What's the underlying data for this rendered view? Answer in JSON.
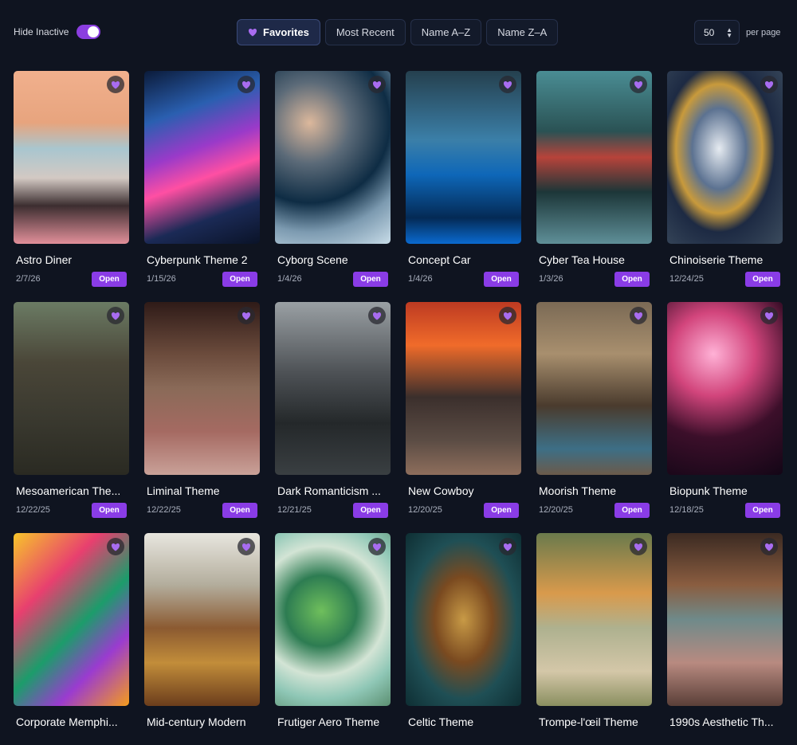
{
  "filters": {
    "hide_inactive_label": "Hide Inactive",
    "hide_inactive_on": true
  },
  "sort": {
    "options": [
      {
        "label": "Favorites",
        "active": true,
        "icon": "heart-icon"
      },
      {
        "label": "Most Recent",
        "active": false
      },
      {
        "label": "Name A–Z",
        "active": false
      },
      {
        "label": "Name Z–A",
        "active": false
      }
    ]
  },
  "pagination": {
    "per_page_value": "50",
    "per_page_label": "per page"
  },
  "colors": {
    "accent": "#8a3ce6",
    "background": "#0f1420"
  },
  "cards": [
    {
      "title": "Astro Diner",
      "date": "2/7/26",
      "open_label": "Open"
    },
    {
      "title": "Cyberpunk Theme 2",
      "date": "1/15/26",
      "open_label": "Open"
    },
    {
      "title": "Cyborg Scene",
      "date": "1/4/26",
      "open_label": "Open"
    },
    {
      "title": "Concept Car",
      "date": "1/4/26",
      "open_label": "Open"
    },
    {
      "title": "Cyber Tea House",
      "date": "1/3/26",
      "open_label": "Open"
    },
    {
      "title": "Chinoiserie Theme",
      "date": "12/24/25",
      "open_label": "Open"
    },
    {
      "title": "Mesoamerican The...",
      "date": "12/22/25",
      "open_label": "Open"
    },
    {
      "title": "Liminal Theme",
      "date": "12/22/25",
      "open_label": "Open"
    },
    {
      "title": "Dark Romanticism ...",
      "date": "12/21/25",
      "open_label": "Open"
    },
    {
      "title": "New Cowboy",
      "date": "12/20/25",
      "open_label": "Open"
    },
    {
      "title": "Moorish Theme",
      "date": "12/20/25",
      "open_label": "Open"
    },
    {
      "title": "Biopunk Theme",
      "date": "12/18/25",
      "open_label": "Open"
    },
    {
      "title": "Corporate Memphi...",
      "date": "",
      "open_label": ""
    },
    {
      "title": "Mid-century Modern",
      "date": "",
      "open_label": ""
    },
    {
      "title": "Frutiger Aero Theme",
      "date": "",
      "open_label": ""
    },
    {
      "title": "Celtic Theme",
      "date": "",
      "open_label": ""
    },
    {
      "title": "Trompe-l'œil Theme",
      "date": "",
      "open_label": ""
    },
    {
      "title": "1990s Aesthetic Th...",
      "date": "",
      "open_label": ""
    }
  ]
}
